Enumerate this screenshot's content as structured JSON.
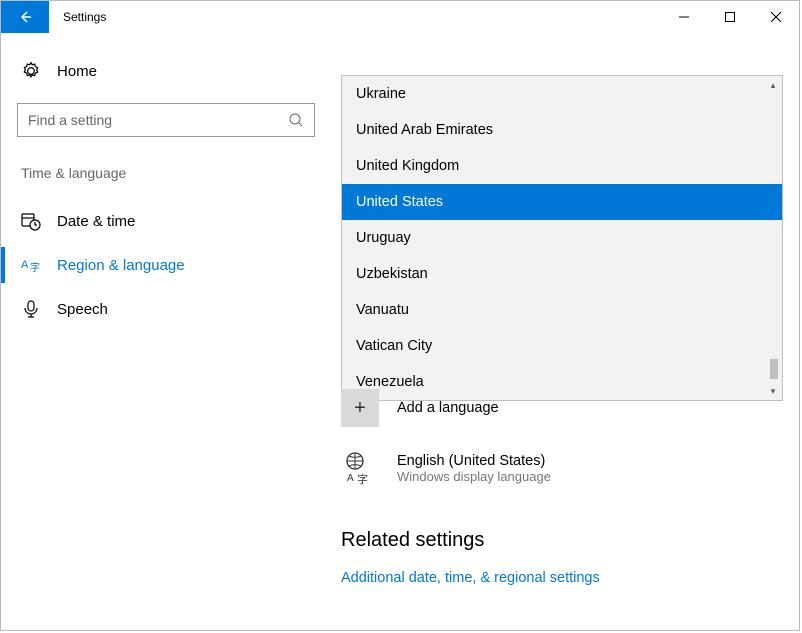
{
  "titlebar": {
    "title": "Settings"
  },
  "sidebar": {
    "home": "Home",
    "search_placeholder": "Find a setting",
    "section": "Time & language",
    "items": [
      {
        "label": "Date & time"
      },
      {
        "label": "Region & language"
      },
      {
        "label": "Speech"
      }
    ]
  },
  "dropdown": {
    "items": [
      "Ukraine",
      "United Arab Emirates",
      "United Kingdom",
      "United States",
      "Uruguay",
      "Uzbekistan",
      "Vanuatu",
      "Vatican City",
      "Venezuela"
    ],
    "selected_index": 3
  },
  "add_language": "Add a language",
  "language_entry": {
    "name": "English (United States)",
    "subtitle": "Windows display language"
  },
  "related": {
    "title": "Related settings",
    "link": "Additional date, time, & regional settings"
  }
}
